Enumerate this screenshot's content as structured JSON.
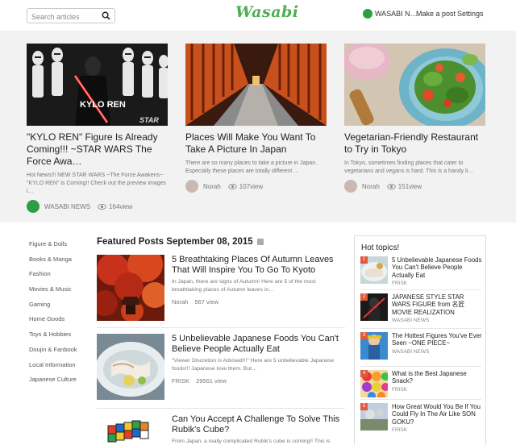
{
  "header": {
    "search_placeholder": "Search articles",
    "logo": "Wasabi",
    "user_name": "WASABI N…",
    "make_post": "Make a post",
    "settings": "Settings"
  },
  "hero": [
    {
      "title": "\"KYLO REN\" Figure Is Already Coming!!! ~STAR WARS The Force Awa…",
      "excerpt": "Hot News!!! NEW STAR WARS ~The Force Awakens~ \"KYLO REN\" is Coming!! Check out the preview images i…",
      "author": "WASABI NEWS",
      "views": "164view",
      "image_text": "KYLO REN",
      "image_tag": "STAR"
    },
    {
      "title": "Places Will Make You Want To Take A Picture In Japan",
      "excerpt": "There are so many places to take a picture in Japan. Especially these places are totally different …",
      "author": "Norah",
      "views": "107view"
    },
    {
      "title": "Vegetarian-Friendly Restaurant to Try in Tokyo",
      "excerpt": "In Tokyo, sometimes finding places that cater to vegetarians and vegans is hard. This is a handy li…",
      "author": "Norah",
      "views": "151view"
    }
  ],
  "categories": [
    "Figure & Dolls",
    "Books & Manga",
    "Fashion",
    "Movies & Music",
    "Gaming",
    "Home Goods",
    "Toys & Hobbies",
    "Doujin & Fanbook",
    "Local Information",
    "Japanese Culture"
  ],
  "featured": {
    "heading": "Featured Posts September 08, 2015",
    "posts": [
      {
        "title": "5 Breathtaking Places Of Autumn Leaves That Will Inspire You To Go To Kyoto",
        "excerpt": "In Japan, there are signs of Autumn! Here are 5 of the most breathtaking places of Autumn leaves in…",
        "author": "Norah",
        "views": "567 view"
      },
      {
        "title": "5 Unbelievable Japanese Foods You Can't Believe People Actually Eat",
        "excerpt": "\"Viewer Discretion is Advised!!!\" Here are 5 unbelievable Japanese foods!!! Japanese love them. But…",
        "author": "FRISK",
        "views": "29561 view"
      },
      {
        "title": "Can You Accept A Challenge To Solve This Rubik's Cube?",
        "excerpt": "From Japan, a really complicated Rubik's cube is coming!! This is",
        "author": "",
        "views": ""
      }
    ]
  },
  "hot_topics": {
    "heading": "Hot topics!",
    "items": [
      {
        "rank": "1",
        "title": "5 Unbelievable Japanese Foods You Can't Believe People Actually Eat",
        "source": "FRISK"
      },
      {
        "rank": "2",
        "title": "JAPANESE STYLE STAR WARS FIGURE from 名匠 MOVIE REALIZATION",
        "source": "WASABI NEWS"
      },
      {
        "rank": "3",
        "title": "The Hottest Figures You've Ever Seen ~ONE PIECE~",
        "source": "WASABI NEWS"
      },
      {
        "rank": "4",
        "title": "What is the Best Japanese Snack?",
        "source": "FRISK"
      },
      {
        "rank": "5",
        "title": "How Great Would You Be If You Could Fly In The Air Like SON GOKU?",
        "source": "FRISK"
      }
    ]
  },
  "colors": {
    "brand": "#4caf50",
    "hero_bg": "#f2f2f2",
    "rank_badge": "#e05a3b"
  }
}
